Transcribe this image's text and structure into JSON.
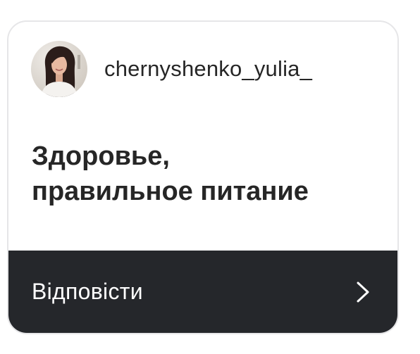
{
  "card": {
    "username": "chernyshenko_yulia_",
    "avatar_icon": "profile-avatar",
    "question_line1": "Здоровье,",
    "question_line2": "правильное питание",
    "reply_label": "Відповісти",
    "reply_icon": "chevron-right-icon"
  },
  "colors": {
    "card_border": "#e6e6e8",
    "text": "#262626",
    "reply_bar_bg": "#25272b",
    "reply_text": "#ffffff"
  }
}
